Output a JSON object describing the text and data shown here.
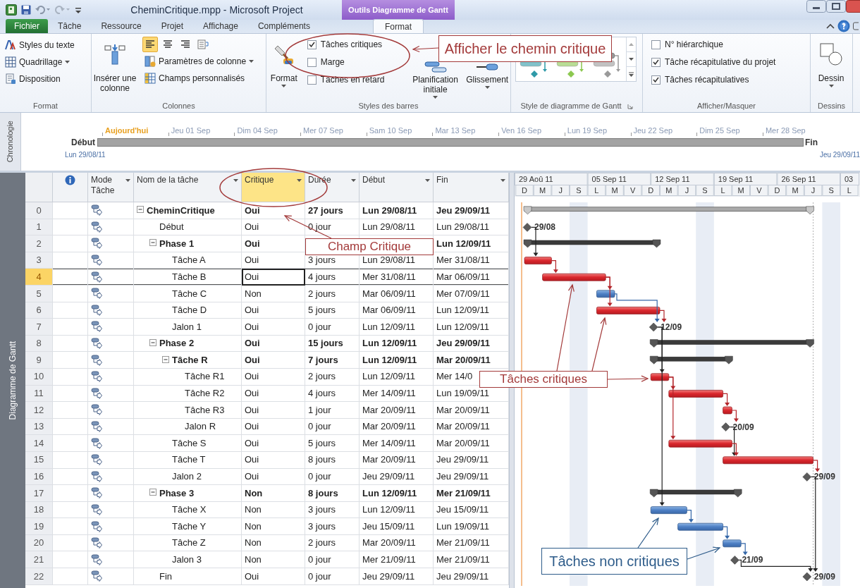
{
  "window": {
    "title": "CheminCritique.mpp - Microsoft Project",
    "context_tab": "Outils Diagramme de Gantt"
  },
  "tabs": [
    {
      "label": "Fichier",
      "kind": "file",
      "selected": false
    },
    {
      "label": "Tâche",
      "kind": "tab",
      "selected": false
    },
    {
      "label": "Ressource",
      "kind": "tab",
      "selected": false
    },
    {
      "label": "Projet",
      "kind": "tab",
      "selected": false
    },
    {
      "label": "Affichage",
      "kind": "tab",
      "selected": false
    },
    {
      "label": "Compléments",
      "kind": "tab",
      "selected": false
    },
    {
      "label": "Format",
      "kind": "context",
      "selected": true
    }
  ],
  "ribbon": {
    "groups": [
      {
        "kind": "format",
        "label": "Format",
        "items": [
          {
            "label": "Styles du texte",
            "dropdown": false
          },
          {
            "label": "Quadrillage",
            "dropdown": true
          },
          {
            "label": "Disposition",
            "dropdown": false
          }
        ]
      },
      {
        "kind": "columns",
        "label": "Colonnes",
        "insert": "Insérer une colonne",
        "align": [
          {
            "selected": true
          },
          {
            "selected": false
          },
          {
            "selected": false
          },
          {
            "selected": false
          }
        ],
        "items": [
          {
            "label": "Paramètres de colonne",
            "dropdown": true
          },
          {
            "label": "Champs personnalisés",
            "dropdown": false
          }
        ]
      },
      {
        "kind": "bar_styles",
        "label": "Styles des barres",
        "format": {
          "label": "Format",
          "dropdown": true
        },
        "checks": [
          {
            "label": "Tâches critiques",
            "checked": true
          },
          {
            "label": "Marge",
            "checked": false
          },
          {
            "label": "Tâches en retard",
            "checked": false
          }
        ],
        "items": [
          {
            "label": "Planification initiale",
            "dropdown": true
          },
          {
            "label": "Glissement",
            "dropdown": true
          }
        ]
      },
      {
        "kind": "gallery",
        "label": "Style de diagramme de Gantt",
        "styles": [
          {
            "color": "#2f9aa8"
          },
          {
            "color": "#8cc850"
          },
          {
            "color": "#9a9a9a"
          }
        ]
      },
      {
        "kind": "show_hide",
        "label": "Afficher/Masquer",
        "checks": [
          {
            "label": "N° hiérarchique",
            "checked": false
          },
          {
            "label": "Tâche récapitulative du projet",
            "checked": true
          },
          {
            "label": "Tâches récapitulatives",
            "checked": true
          }
        ]
      },
      {
        "kind": "drawings",
        "label": "Dessins",
        "items": [
          {
            "label": "Dessin",
            "dropdown": true
          }
        ]
      }
    ]
  },
  "timeline": {
    "side_label": "Chronologie",
    "today": "Aujourd'hui",
    "ticks": [
      "Jeu 01 Sep",
      "Dim 04 Sep",
      "Mer 07 Sep",
      "Sam 10 Sep",
      "Mar 13 Sep",
      "Ven 16 Sep",
      "Lun 19 Sep",
      "Jeu 22 Sep",
      "Dim 25 Sep",
      "Mer 28 Sep"
    ],
    "start_label": "Début",
    "start_date": "Lun 29/08/11",
    "end_label": "Fin",
    "end_date": "Jeu 29/09/11"
  },
  "view_label": "Diagramme de Gantt",
  "columns": [
    {
      "kind": "info",
      "selected": false
    },
    {
      "kind": "text",
      "label": "Mode Tâche",
      "selected": false
    },
    {
      "kind": "text",
      "label": "Nom de la tâche",
      "selected": false
    },
    {
      "kind": "text",
      "label": "Critique",
      "selected": true
    },
    {
      "kind": "text",
      "label": "Durée",
      "selected": false
    },
    {
      "kind": "text",
      "label": "Début",
      "selected": false
    },
    {
      "kind": "text",
      "label": "Fin",
      "selected": false
    }
  ],
  "tasks": [
    {
      "id": "0",
      "name": "CheminCritique",
      "kind": "project",
      "critique": "Oui",
      "duree": "27 jours",
      "debut": "Lun 29/08/11",
      "fin": "Jeu 29/09/11",
      "expanded": true,
      "selected": false,
      "children": [
        {
          "id": "1",
          "name": "Début",
          "kind": "milestone",
          "critique": "Oui",
          "duree": "0 jour",
          "debut": "Lun 29/08/11",
          "fin": "Lun 29/08/11",
          "selected": false,
          "bar_label": "29/08"
        },
        {
          "id": "2",
          "name": "Phase 1",
          "kind": "summary",
          "critique": "Oui",
          "fin": "Lun 12/09/11",
          "expanded": true,
          "selected": false,
          "children": [
            {
              "id": "3",
              "name": "Tâche A",
              "kind": "task",
              "critique": "Oui",
              "critical": true,
              "duree": "3 jours",
              "debut": "Lun 29/08/11",
              "fin": "Mer 31/08/11",
              "selected": false
            },
            {
              "id": "4",
              "name": "Tâche B",
              "kind": "task",
              "critique": "Oui",
              "critical": true,
              "duree": "4 jours",
              "debut": "Mer 31/08/11",
              "fin": "Mar 06/09/11",
              "selected": true
            },
            {
              "id": "5",
              "name": "Tâche C",
              "kind": "task",
              "critique": "Non",
              "critical": false,
              "duree": "2 jours",
              "debut": "Mar 06/09/11",
              "fin": "Mer 07/09/11",
              "selected": false
            },
            {
              "id": "6",
              "name": "Tâche D",
              "kind": "task",
              "critique": "Oui",
              "critical": true,
              "duree": "5 jours",
              "debut": "Mar 06/09/11",
              "fin": "Lun 12/09/11",
              "selected": false
            },
            {
              "id": "7",
              "name": "Jalon 1",
              "kind": "milestone",
              "critique": "Oui",
              "duree": "0 jour",
              "debut": "Lun 12/09/11",
              "fin": "Lun 12/09/11",
              "selected": false,
              "bar_label": "12/09"
            }
          ]
        },
        {
          "id": "8",
          "name": "Phase 2",
          "kind": "summary",
          "critique": "Oui",
          "duree": "15 jours",
          "debut": "Lun 12/09/11",
          "fin": "Jeu 29/09/11",
          "expanded": true,
          "selected": false,
          "children": [
            {
              "id": "9",
              "name": "Tâche R",
              "kind": "summary",
              "critique": "Oui",
              "duree": "7 jours",
              "debut": "Lun 12/09/11",
              "fin": "Mar 20/09/11",
              "expanded": true,
              "selected": false,
              "children": [
                {
                  "id": "10",
                  "name": "Tâche R1",
                  "kind": "task",
                  "critique": "Oui",
                  "critical": true,
                  "duree": "2 jours",
                  "debut": "Lun 12/09/11",
                  "fin": "Mer 14/0",
                  "selected": false
                },
                {
                  "id": "11",
                  "name": "Tâche R2",
                  "kind": "task",
                  "critique": "Oui",
                  "critical": true,
                  "duree": "4 jours",
                  "debut": "Mer 14/09/11",
                  "fin": "Lun 19/09/11",
                  "selected": false
                },
                {
                  "id": "12",
                  "name": "Tâche R3",
                  "kind": "task",
                  "critique": "Oui",
                  "critical": true,
                  "duree": "1 jour",
                  "debut": "Mar 20/09/11",
                  "fin": "Mar 20/09/11",
                  "selected": false
                },
                {
                  "id": "13",
                  "name": "Jalon R",
                  "kind": "milestone",
                  "critique": "Oui",
                  "duree": "0 jour",
                  "debut": "Mar 20/09/11",
                  "fin": "Mar 20/09/11",
                  "selected": false,
                  "bar_label": "20/09"
                }
              ]
            },
            {
              "id": "14",
              "name": "Tâche S",
              "kind": "task",
              "critique": "Oui",
              "critical": true,
              "duree": "5 jours",
              "debut": "Mer 14/09/11",
              "fin": "Mar 20/09/11",
              "selected": false
            },
            {
              "id": "15",
              "name": "Tâche T",
              "kind": "task",
              "critique": "Oui",
              "critical": true,
              "duree": "8 jours",
              "debut": "Mar 20/09/11",
              "fin": "Jeu 29/09/11",
              "selected": false
            },
            {
              "id": "16",
              "name": "Jalon 2",
              "kind": "milestone",
              "critique": "Oui",
              "duree": "0 jour",
              "debut": "Jeu 29/09/11",
              "fin": "Jeu 29/09/11",
              "selected": false,
              "bar_label": "29/09"
            }
          ]
        },
        {
          "id": "17",
          "name": "Phase 3",
          "kind": "summary",
          "critique": "Non",
          "duree": "8 jours",
          "debut": "Lun 12/09/11",
          "fin": "Mer 21/09/11",
          "expanded": true,
          "selected": false,
          "children": [
            {
              "id": "18",
              "name": "Tâche X",
              "kind": "task",
              "critique": "Non",
              "critical": false,
              "duree": "3 jours",
              "debut": "Lun 12/09/11",
              "fin": "Jeu 15/09/11",
              "selected": false
            },
            {
              "id": "19",
              "name": "Tâche Y",
              "kind": "task",
              "critique": "Non",
              "critical": false,
              "duree": "3 jours",
              "debut": "Jeu 15/09/11",
              "fin": "Lun 19/09/11",
              "selected": false
            },
            {
              "id": "20",
              "name": "Tâche Z",
              "kind": "task",
              "critique": "Non",
              "critical": false,
              "duree": "2 jours",
              "debut": "Mar 20/09/11",
              "fin": "Mer 21/09/11",
              "selected": false
            },
            {
              "id": "21",
              "name": "Jalon 3",
              "kind": "milestone",
              "critique": "Non",
              "duree": "0 jour",
              "debut": "Mer 21/09/11",
              "fin": "Mer 21/09/11",
              "selected": false,
              "bar_label": "21/09"
            }
          ]
        },
        {
          "id": "22",
          "name": "Fin",
          "kind": "milestone",
          "critique": "Oui",
          "duree": "0 jour",
          "debut": "Jeu 29/09/11",
          "fin": "Jeu 29/09/11",
          "selected": false,
          "bar_label": "29/09"
        }
      ]
    }
  ],
  "gantt": {
    "timescale": {
      "weeks": [
        "29 Aoû 11",
        "05 Sep 11",
        "12 Sep 11",
        "19 Sep 11",
        "26 Sep 11",
        "03"
      ],
      "days": [
        "D",
        "M",
        "J",
        "S",
        "L",
        "M",
        "V",
        "D",
        "M",
        "J",
        "S",
        "L",
        "M",
        "V",
        "D",
        "M",
        "J",
        "S",
        "L"
      ]
    },
    "links_shown": true
  },
  "annotations": [
    {
      "text": "Afficher le chemin critique",
      "color": "#a33a3a"
    },
    {
      "text": "Champ Critique",
      "color": "#a33a3a"
    },
    {
      "text": "Tâches critiques",
      "color": "#a33a3a"
    },
    {
      "text": "Tâches non critiques",
      "color": "#2e5c8a"
    }
  ]
}
